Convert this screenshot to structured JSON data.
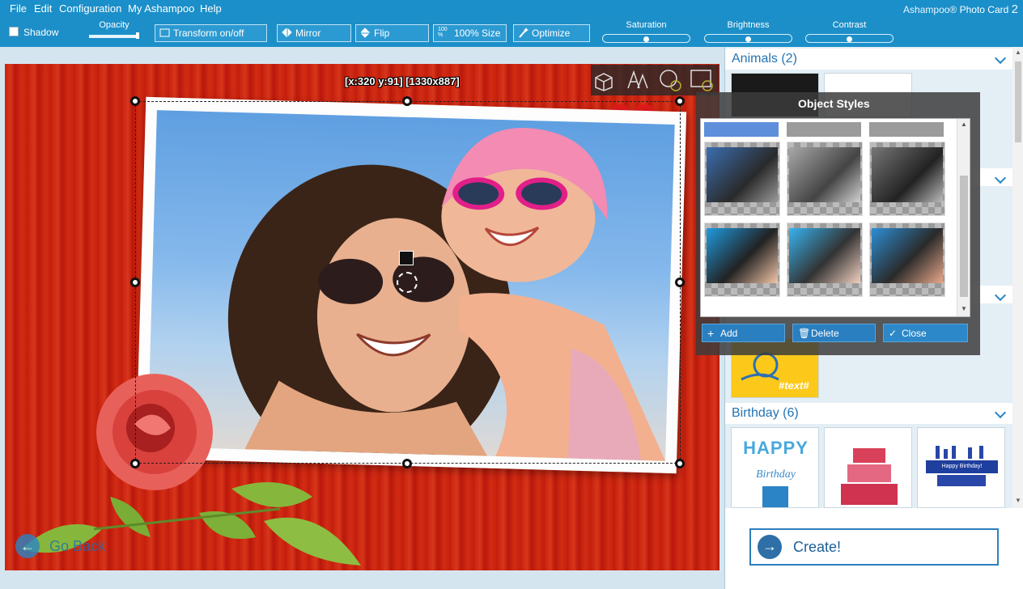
{
  "menu": {
    "items": [
      "File",
      "Edit",
      "Configuration",
      "My Ashampoo",
      "Help"
    ],
    "app_brand": "Ashampoo®",
    "app_name": "Photo Card",
    "app_version": "2"
  },
  "toolbar": {
    "shadow_label": "Shadow",
    "opacity_label": "Opacity",
    "opacity_value": 0.95,
    "transform_label": "Transform on/off",
    "mirror_label": "Mirror",
    "flip_label": "Flip",
    "size_label": "100% Size",
    "size_icon_text": "100 %",
    "optimize_label": "Optimize",
    "saturation_label": "Saturation",
    "saturation_value": 0.5,
    "brightness_label": "Brightness",
    "brightness_value": 0.5,
    "contrast_label": "Contrast",
    "contrast_value": 0.5
  },
  "canvas": {
    "coord_label": "[x:320 y:91] [1330x887]",
    "go_back_label": "Go Back"
  },
  "categories": [
    {
      "label": "Animals (2)"
    },
    {
      "label": "Birthday (6)"
    }
  ],
  "thumbs": {
    "birthday_1_text": "HAPPY",
    "birthday_1_sub": "Birthday",
    "birthday_3_text": "Happy Birthday!",
    "yellow_text": "#text#"
  },
  "object_styles": {
    "title": "Object Styles",
    "add_label": "Add",
    "delete_label": "Delete",
    "close_label": "Close"
  },
  "create_label": "Create!",
  "icons": {
    "back": "arrow-left-icon",
    "create": "arrow-right-icon"
  },
  "colors": {
    "accent": "#1c8fc8",
    "button": "#2a7fc0",
    "stage": "#c8230f"
  }
}
